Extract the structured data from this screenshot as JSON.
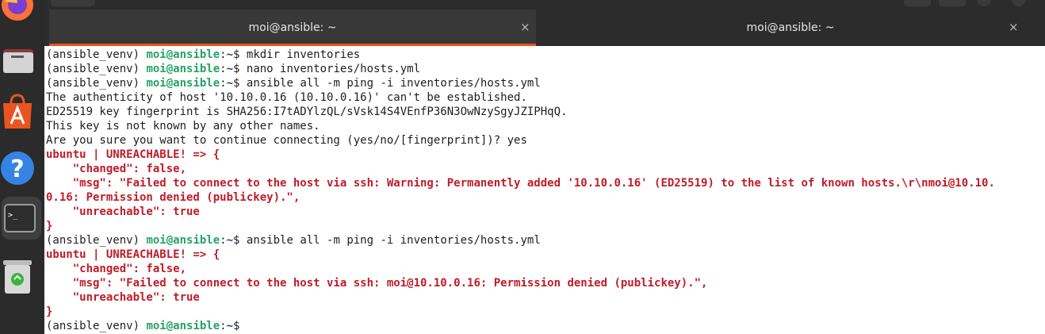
{
  "window": {
    "tabs": [
      {
        "label": "moi@ansible: ~",
        "active": true
      },
      {
        "label": "moi@ansible: ~",
        "active": false
      }
    ],
    "close_glyph": "×"
  },
  "dock": {
    "items": [
      "firefox-icon",
      "files-icon",
      "app-store-icon",
      "help-icon",
      "terminal-icon",
      "trash-icon"
    ],
    "terminal_prompt_glyph": ">_"
  },
  "terminal": {
    "prompt": {
      "venv": "(ansible_venv) ",
      "user_host": "moi@ansible",
      "sep": ":",
      "path": "~",
      "sign": "$ "
    },
    "lines": [
      {
        "kind": "prompt",
        "cmd": "mkdir inventories"
      },
      {
        "kind": "prompt",
        "cmd": "nano inventories/hosts.yml"
      },
      {
        "kind": "prompt",
        "cmd": "ansible all -m ping -i inventories/hosts.yml"
      },
      {
        "kind": "plain",
        "text": "The authenticity of host '10.10.0.16 (10.10.0.16)' can't be established."
      },
      {
        "kind": "plain",
        "text": "ED25519 key fingerprint is SHA256:I7tADYlzQL/sVsk14S4VEnfP36N3OwNzySgyJZIPHqQ."
      },
      {
        "kind": "plain",
        "text": "This key is not known by any other names."
      },
      {
        "kind": "plain",
        "text": "Are you sure you want to continue connecting (yes/no/[fingerprint])? yes"
      },
      {
        "kind": "error",
        "text": "ubuntu | UNREACHABLE! => {"
      },
      {
        "kind": "error",
        "text": "    \"changed\": false,"
      },
      {
        "kind": "error",
        "text": "    \"msg\": \"Failed to connect to the host via ssh: Warning: Permanently added '10.10.0.16' (ED25519) to the list of known hosts.\\r\\nmoi@10.10."
      },
      {
        "kind": "error",
        "text": "0.16: Permission denied (publickey).\","
      },
      {
        "kind": "error",
        "text": "    \"unreachable\": true"
      },
      {
        "kind": "error",
        "text": "}"
      },
      {
        "kind": "prompt",
        "cmd": "ansible all -m ping -i inventories/hosts.yml"
      },
      {
        "kind": "error",
        "text": "ubuntu | UNREACHABLE! => {"
      },
      {
        "kind": "error",
        "text": "    \"changed\": false,"
      },
      {
        "kind": "error",
        "text": "    \"msg\": \"Failed to connect to the host via ssh: moi@10.10.0.16: Permission denied (publickey).\","
      },
      {
        "kind": "error",
        "text": "    \"unreachable\": true"
      },
      {
        "kind": "error",
        "text": "}"
      },
      {
        "kind": "prompt",
        "cmd": ""
      }
    ]
  },
  "colors": {
    "prompt_user": "#26a269",
    "prompt_path": "#12488b",
    "error": "#c01c28",
    "tab_accent": "#e95420"
  }
}
